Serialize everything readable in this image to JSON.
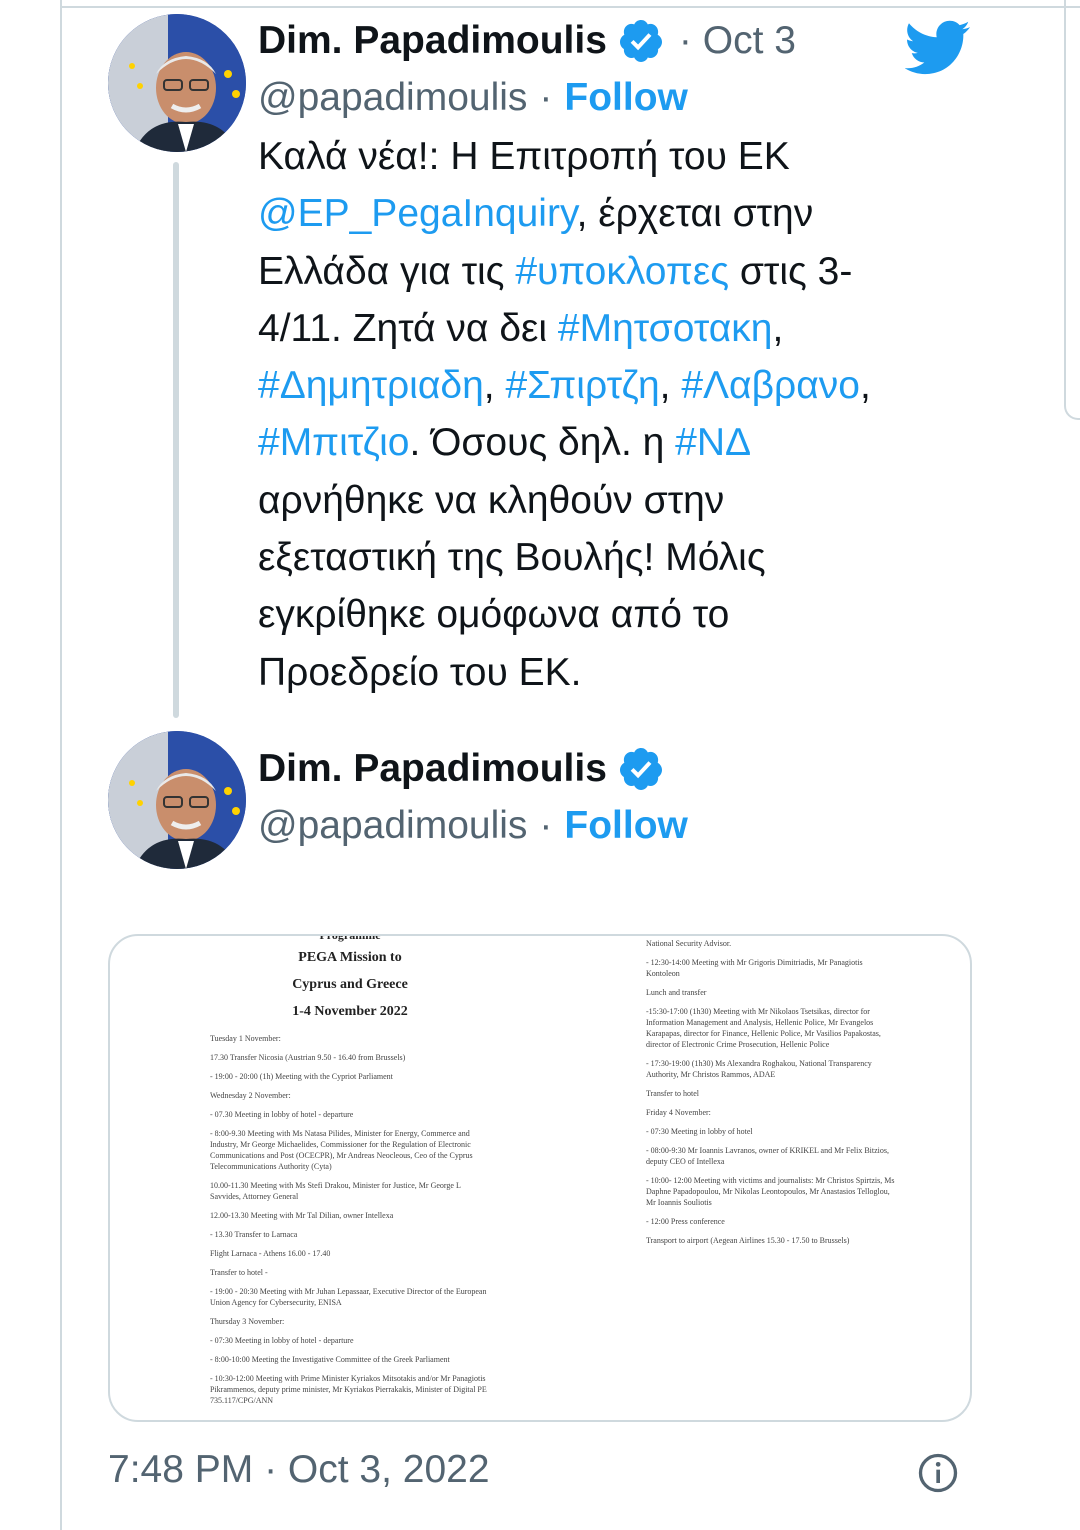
{
  "colors": {
    "link": "#1d9bf0",
    "text": "#0f1419",
    "secondary": "#536471",
    "border": "#cfd9de"
  },
  "brand": {
    "logo": "twitter-bird-icon"
  },
  "tweet1": {
    "author_name": "Dim. Papadimoulis",
    "verified_icon": "verified-badge-icon",
    "date": "· Oct 3",
    "handle": "@papadimoulis",
    "dot": "·",
    "follow_label": "Follow",
    "text_lines": [
      [
        {
          "t": "Καλά νέα!: Η Επιτροπή του ΕΚ",
          "link": false
        }
      ],
      [
        {
          "t": "@EP_PegaInquiry",
          "link": true
        },
        {
          "t": ", έρχεται στην",
          "link": false
        }
      ],
      [
        {
          "t": "Ελλάδα για τις ",
          "link": false
        },
        {
          "t": "#υποκλοπες",
          "link": true
        },
        {
          "t": " στις 3-",
          "link": false
        }
      ],
      [
        {
          "t": "4/11. Ζητά να δει ",
          "link": false
        },
        {
          "t": "#Μητσοτακη",
          "link": true
        },
        {
          "t": ",",
          "link": false
        }
      ],
      [
        {
          "t": "#Δημητριαδη",
          "link": true
        },
        {
          "t": ", ",
          "link": false
        },
        {
          "t": "#Σπιρτζη",
          "link": true
        },
        {
          "t": ", ",
          "link": false
        },
        {
          "t": "#Λαβρανο",
          "link": true
        },
        {
          "t": ",",
          "link": false
        }
      ],
      [
        {
          "t": "#Μπιτζιο",
          "link": true
        },
        {
          "t": ". Όσους δηλ. η ",
          "link": false
        },
        {
          "t": "#ΝΔ",
          "link": true
        }
      ],
      [
        {
          "t": "αρνήθηκε να κληθούν στην",
          "link": false
        }
      ],
      [
        {
          "t": "εξεταστική της Βουλής! Μόλις",
          "link": false
        }
      ],
      [
        {
          "t": "εγκρίθηκε ομόφωνα από το",
          "link": false
        }
      ],
      [
        {
          "t": "Προεδρείο του ΕΚ.",
          "link": false
        }
      ]
    ]
  },
  "tweet2": {
    "author_name": "Dim. Papadimoulis",
    "verified_icon": "verified-badge-icon",
    "handle": "@papadimoulis",
    "dot": "·",
    "follow_label": "Follow"
  },
  "document": {
    "title_partial": "Programme",
    "title_lines": [
      "PEGA Mission to",
      "Cyprus and Greece",
      "1-4 November 2022"
    ],
    "left_lines": [
      "Tuesday 1 November:",
      "17.30 Transfer Nicosia (Austrian 9.50 - 16.40 from Brussels)",
      "- 19:00 - 20:00 (1h) Meeting with the Cypriot Parliament",
      "Wednesday 2 November:",
      "- 07.30 Meeting in lobby of hotel - departure",
      "- 8:00-9.30 Meeting with Ms Natasa Pilides, Minister for Energy, Commerce and Industry, Mr George Michaelides, Commissioner for the Regulation of Electronic Communications and Post (OCECPR), Mr Andreas Neocleous, Ceo of the Cyprus Telecommunications Authority (Cyta)",
      "10.00-11.30 Meeting with Ms Stefi Drakou, Minister for Justice, Mr George L Savvides, Attorney General",
      "12.00-13.30 Meeting with Mr Tal Dilian, owner Intellexa",
      "- 13.30 Transfer to Larnaca",
      "Flight Larnaca - Athens 16.00 - 17.40",
      "Transfer to hotel -",
      "- 19:00 - 20:30 Meeting with Mr Juhan Lepassaar, Executive Director of the European Union Agency for Cybersecurity, ENISA",
      "Thursday 3 November:",
      "- 07:30 Meeting in lobby of hotel - departure",
      "- 8:00-10:00 Meeting the Investigative Committee of the Greek Parliament",
      "- 10:30-12:00 Meeting with Prime Minister Kyriakos Mitsotakis and/or Mr Panagiotis Pikrammenos, deputy prime minister, Mr Kyriakos Pierrakakis, Minister of Digital PE 735.117/CPG/ANN"
    ],
    "right_lines": [
      "National Security Advisor.",
      "- 12:30-14:00 Meeting with Mr Grigoris Dimitriadis, Mr Panagiotis Kontoleon",
      "Lunch and transfer",
      "-15:30-17:00 (1h30) Meeting with Mr Nikolaos Tsetsikas, director for Information Management and Analysis, Hellenic Police, Mr Evangelos Karapapas, director for Finance, Hellenic Police, Mr Vasilios Papakostas, director of Electronic Crime Prosecution, Hellenic Police",
      "- 17:30-19:00 (1h30) Ms Alexandra Roghakou, National Transparency Authority, Mr Christos Rammos, ADAE",
      "Transfer to hotel",
      "Friday 4 November:",
      "- 07:30 Meeting in lobby of hotel",
      "- 08:00-9:30 Mr Ioannis Lavranos, owner of KRIKEL and Mr Felix Bitzios, deputy CEO of Intellexa",
      "- 10:00- 12:00 Meeting with victims and journalists: Mr Christos Spirtzis, Ms Daphne Papadopoulou, Mr Nikolas Leontopoulos, Mr Anastasios Telloglou, Mr Ioannis Souliotis",
      "- 12:00 Press conference",
      "Transport to airport (Aegean Airlines 15.30 - 17.50 to Brussels)"
    ]
  },
  "timestamp": "7:48 PM · Oct 3, 2022",
  "info_icon": "info-icon"
}
